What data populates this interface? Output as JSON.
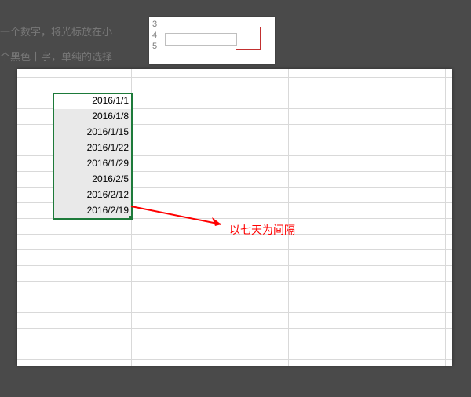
{
  "background": {
    "text_a": "一个数字，将光标放在小",
    "text_b": "个黑色十字，单纯的选择"
  },
  "mini": {
    "rownums": "3\n4\n5"
  },
  "selection": {
    "rows": [
      "2016/1/1",
      "2016/1/8",
      "2016/1/15",
      "2016/1/22",
      "2016/1/29",
      "2016/2/5",
      "2016/2/12",
      "2016/2/19"
    ]
  },
  "annotation": {
    "label": "以七天为间隔"
  },
  "colors": {
    "selection_border": "#1d7a3a",
    "annotation": "#ff0000",
    "gridline": "#d9d9d9"
  }
}
